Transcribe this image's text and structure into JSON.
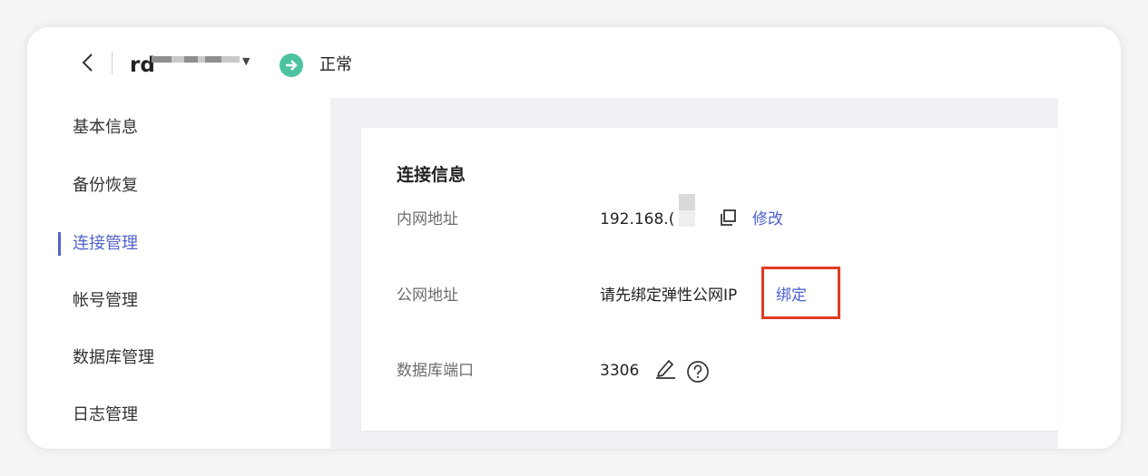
{
  "header": {
    "back_icon": "chevron-left-icon",
    "instance_name": "rd",
    "dropdown_icon": "caret-down-icon",
    "status_icon": "arrow-right-circle-icon",
    "status_text": "正常",
    "status_color": "#4cc2a1"
  },
  "sidebar": {
    "active_color": "#5263c9",
    "items": [
      {
        "label": "基本信息"
      },
      {
        "label": "备份恢复"
      },
      {
        "label": "连接管理",
        "active": true
      },
      {
        "label": "帐号管理"
      },
      {
        "label": "数据库管理"
      },
      {
        "label": "日志管理"
      }
    ]
  },
  "connection": {
    "title": "连接信息",
    "private_address": {
      "label": "内网地址",
      "value": "192.168.(",
      "copy_icon": "copy-icon",
      "action": "修改"
    },
    "public_address": {
      "label": "公网地址",
      "value": "请先绑定弹性公网IP",
      "action": "绑定",
      "highlight_color": "#e03b24"
    },
    "db_port": {
      "label": "数据库端口",
      "value": "3306",
      "edit_icon": "edit-icon",
      "help_icon": "help-icon"
    },
    "link_color": "#4b5fd1"
  }
}
